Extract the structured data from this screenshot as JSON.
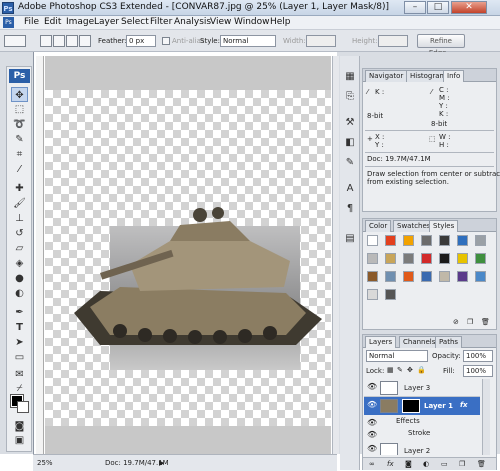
{
  "window": {
    "title": "Adobe Photoshop CS3 Extended - [CONVAR87.jpg @ 25% (Layer 1, Layer Mask/8)]",
    "minimize": "–",
    "maximize": "□",
    "close": "✕"
  },
  "menu": [
    "File",
    "Edit",
    "Image",
    "Layer",
    "Select",
    "Filter",
    "Analysis",
    "View",
    "Window",
    "Help"
  ],
  "options": {
    "feather_label": "Feather:",
    "feather_value": "0 px",
    "antialias_label": "Anti-alias",
    "style_label": "Style:",
    "style_value": "Normal",
    "width_label": "Width:",
    "height_label": "Height:",
    "refine_edge": "Refine Edge..."
  },
  "toolbox": {
    "logo": "Ps",
    "tools": [
      "move-tool",
      "marquee-tool",
      "lasso-tool",
      "quick-selection-tool",
      "crop-tool",
      "slice-tool",
      "healing-brush-tool",
      "brush-tool",
      "clone-stamp-tool",
      "history-brush-tool",
      "eraser-tool",
      "paint-bucket-tool",
      "blur-tool",
      "dodge-tool",
      "pen-tool",
      "type-tool",
      "path-selection-tool",
      "rectangle-tool",
      "notes-tool",
      "eyedropper-tool",
      "hand-tool",
      "zoom-tool"
    ]
  },
  "status": {
    "zoom": "25%",
    "doc": "Doc: 19.7M/47.1M"
  },
  "info_panel": {
    "tabs": [
      "Navigator",
      "Histogram",
      "Info"
    ],
    "active_tab": "Info",
    "k_label": "K :",
    "cmyk_labels": [
      "C :",
      "M :",
      "Y :",
      "K :"
    ],
    "bit_left": "8-bit",
    "bit_right": "8-bit",
    "x_label": "X :",
    "y_label": "Y :",
    "w_label": "W :",
    "h_label": "H :",
    "doc": "Doc: 19.7M/47.1M",
    "hint": [
      "Draw selection from center or subtract",
      "from existing selection."
    ]
  },
  "styles_panel": {
    "tabs": [
      "Color",
      "Swatches",
      "Styles"
    ],
    "active_tab": "Styles",
    "colors": [
      "#ffffff",
      "#e3401e",
      "#f2a200",
      "#6b6b6b",
      "#3a3a3a",
      "#2f6fbd",
      "#9aa0a6",
      "#b9b9b9",
      "#c8a55a",
      "#7b7b7b",
      "#d22a2a",
      "#1b1b1b",
      "#e7c300",
      "#3f8f3f",
      "#8a5a2a",
      "#6f8fb0",
      "#e05a1a",
      "#3a6ab0",
      "#c0b8a8",
      "#5a3a8a",
      "#4a88c8",
      "#d9d9d9",
      "#555555"
    ]
  },
  "layers_panel": {
    "tabs": [
      "Layers",
      "Channels",
      "Paths"
    ],
    "active_tab": "Layers",
    "blend_mode": "Normal",
    "opacity_label": "Opacity:",
    "opacity": "100%",
    "lock_label": "Lock:",
    "fill_label": "Fill:",
    "fill": "100%",
    "layers": [
      {
        "name": "Layer 3",
        "selected": false
      },
      {
        "name": "Layer 1",
        "selected": true,
        "fx": "fx"
      },
      {
        "name": "Effects",
        "sub": true
      },
      {
        "name": "Stroke",
        "sub": true
      },
      {
        "name": "Layer 2",
        "selected": false
      }
    ],
    "footer_icons": [
      "link-icon",
      "fx-icon",
      "mask-icon",
      "adjustment-icon",
      "folder-icon",
      "new-layer-icon",
      "trash-icon"
    ]
  }
}
